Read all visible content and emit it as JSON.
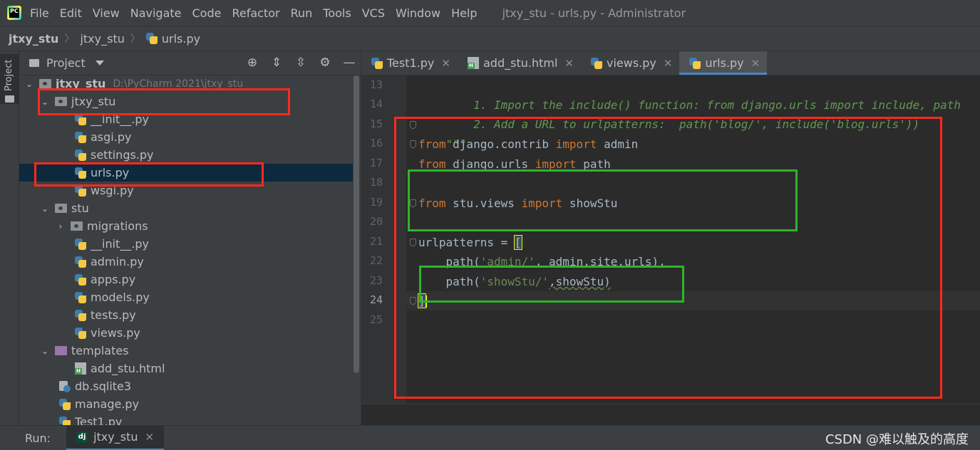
{
  "menubar": {
    "items": [
      "File",
      "Edit",
      "View",
      "Navigate",
      "Code",
      "Refactor",
      "Run",
      "Tools",
      "VCS",
      "Window",
      "Help"
    ],
    "window_title": "jtxy_stu - urls.py - Administrator"
  },
  "breadcrumb": {
    "project": "jtxy_stu",
    "package": "jtxy_stu",
    "file": "urls.py"
  },
  "tool_strip": {
    "project_label": "Project"
  },
  "project_panel": {
    "title": "Project",
    "tree": [
      {
        "label": "jtxy_stu",
        "path": "D:\\PyCharm 2021\\jtxy_stu"
      },
      {
        "label": "jtxy_stu"
      },
      {
        "label": "__init__.py"
      },
      {
        "label": "asgi.py"
      },
      {
        "label": "settings.py"
      },
      {
        "label": "urls.py"
      },
      {
        "label": "wsgi.py"
      },
      {
        "label": "stu"
      },
      {
        "label": "migrations"
      },
      {
        "label": "__init__.py"
      },
      {
        "label": "admin.py"
      },
      {
        "label": "apps.py"
      },
      {
        "label": "models.py"
      },
      {
        "label": "tests.py"
      },
      {
        "label": "views.py"
      },
      {
        "label": "templates"
      },
      {
        "label": "add_stu.html"
      },
      {
        "label": "db.sqlite3"
      },
      {
        "label": "manage.py"
      },
      {
        "label": "Test1.py"
      }
    ]
  },
  "editor_tabs": [
    {
      "label": "Test1.py",
      "active": false
    },
    {
      "label": "add_stu.html",
      "active": false
    },
    {
      "label": "views.py",
      "active": false
    },
    {
      "label": "urls.py",
      "active": true
    }
  ],
  "editor": {
    "line_numbers": [
      "13",
      "14",
      "15",
      "16",
      "17",
      "18",
      "19",
      "20",
      "21",
      "22",
      "23",
      "24",
      "25"
    ],
    "current_line": "24",
    "code": {
      "l13": "    1. Import the include() function: from django.urls import include, path",
      "l14": "    2. Add a URL to urlpatterns:  path('blog/', include('blog.urls'))",
      "l15": "\"\"\"",
      "l16_kw1": "from",
      "l16_mod": " django.contrib ",
      "l16_kw2": "import",
      "l16_name": " admin",
      "l17_kw1": "from",
      "l17_mod": " django.urls ",
      "l17_kw2": "import",
      "l17_name": " path",
      "l19_kw1": "from",
      "l19_mod": " stu.views ",
      "l19_kw2": "import",
      "l19_name": " showStu",
      "l21_name": "urlpatterns = ",
      "l21_bracket": "[",
      "l22_a": "    path(",
      "l22_str": "'admin/'",
      "l22_b": ", admin.site.urls),",
      "l23_a": "    path(",
      "l23_str": "'showStu/'",
      "l23_b": ",showStu)",
      "l24_bracket": "]"
    }
  },
  "runbar": {
    "label": "Run:",
    "tab_label": "jtxy_stu",
    "tab_icon_text": "dj"
  },
  "watermark": "CSDN @难以触及的高度",
  "colors": {
    "annotation_red": "#ff2a1f",
    "annotation_green": "#2db52a",
    "selection": "#0d293e",
    "accent": "#4a88c7"
  }
}
